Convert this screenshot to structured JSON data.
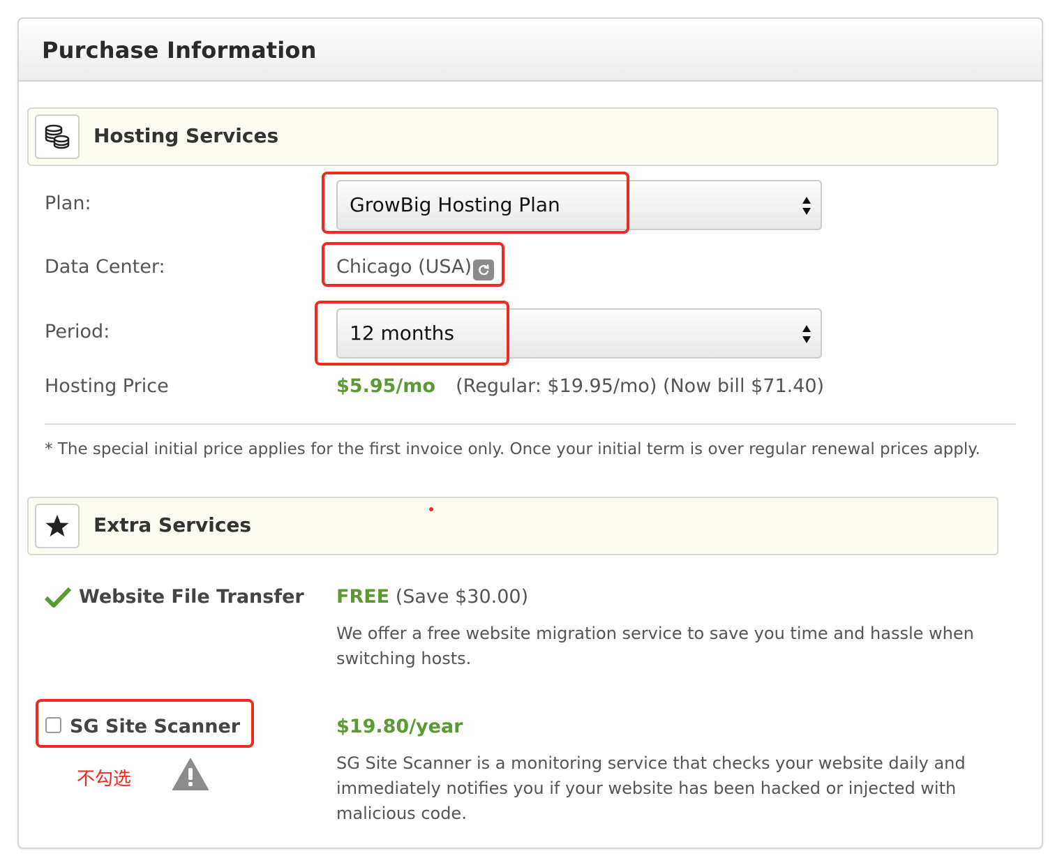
{
  "panel": {
    "title": "Purchase Information"
  },
  "hosting": {
    "section_title": "Hosting Services",
    "section_icon": "database-coins-icon",
    "plan": {
      "label": "Plan:",
      "value": "GrowBig Hosting Plan"
    },
    "data_center": {
      "label": "Data Center:",
      "value": "Chicago (USA)",
      "change_icon": "refresh-icon"
    },
    "period": {
      "label": "Period:",
      "value": "12 months"
    },
    "price": {
      "label": "Hosting Price",
      "promo": "$5.95/mo",
      "regular": "(Regular: $19.95/mo) (Now bill $71.40)"
    },
    "note": "* The special initial price applies for the first invoice only. Once your initial term is over regular renewal prices apply."
  },
  "extra": {
    "section_title": "Extra Services",
    "section_icon": "star-icon",
    "file_transfer": {
      "name": "Website File Transfer",
      "status_icon": "checkmark-icon",
      "price": "FREE",
      "savings": "(Save $30.00)",
      "description": "We offer a free website migration service to save you time and hassle when switching hosts."
    },
    "site_scanner": {
      "name": "SG Site Scanner",
      "checked": false,
      "price": "$19.80/year",
      "description": "SG Site Scanner is a monitoring service that checks your website daily and immediately notifies you if your website has been hacked or injected with malicious code."
    }
  },
  "annotations": {
    "uncheck_note": "不勾选",
    "warning_icon": "warning-triangle-icon",
    "highlight_color": "#ee2b22"
  },
  "colors": {
    "price_green": "#5a9a32",
    "section_bg": "#fefdf1"
  }
}
